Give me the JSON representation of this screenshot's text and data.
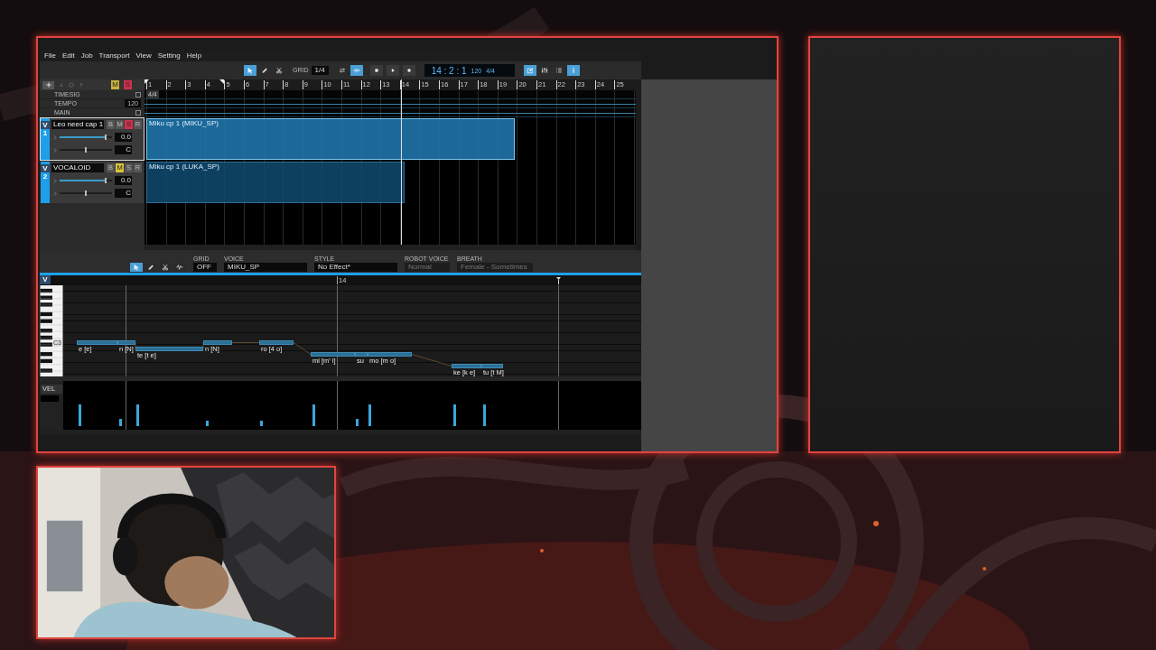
{
  "menu": [
    "File",
    "Edit",
    "Job",
    "Transport",
    "View",
    "Setting",
    "Help"
  ],
  "toolbar": {
    "tools": [
      {
        "kind": "select",
        "selected": true
      },
      {
        "kind": "pencil",
        "selected": false
      },
      {
        "kind": "scissors",
        "selected": false
      }
    ],
    "grid": {
      "label": "GRID",
      "value": "1/4"
    },
    "toggles": [
      {
        "kind": "loop",
        "on": false
      },
      {
        "kind": "snap",
        "on": true
      }
    ],
    "transport": [
      {
        "kind": "stop"
      },
      {
        "kind": "play"
      },
      {
        "kind": "record"
      }
    ],
    "time": "14 : 2 : 1",
    "tempo": "120",
    "meter": "4/4",
    "panels": [
      {
        "kind": "edit",
        "selected": true
      },
      {
        "kind": "mixer",
        "selected": false
      },
      {
        "kind": "list",
        "selected": false
      },
      {
        "kind": "info",
        "selected": true
      }
    ]
  },
  "arrangement": {
    "header_buttons": [
      {
        "label": "M",
        "kind": "mute"
      },
      {
        "label": "S",
        "kind": "solo"
      }
    ],
    "conductor": [
      {
        "label": "TIMESIG",
        "checked": false
      },
      {
        "label": "TEMPO",
        "value": "120"
      },
      {
        "label": "MAIN",
        "checked": false
      }
    ],
    "measures": [
      "1",
      "2",
      "3",
      "4",
      "5",
      "6",
      "7",
      "8",
      "9",
      "10",
      "11",
      "12",
      "13",
      "14",
      "15",
      "16",
      "17",
      "18",
      "19",
      "20",
      "21",
      "22",
      "23",
      "24",
      "25"
    ],
    "timesig_marker": "4/4",
    "tracks": [
      {
        "letter": "V",
        "number": "1",
        "name": "Leo need cap 1",
        "selected": true,
        "buttons": [
          {
            "label": "B",
            "kind": "bounce",
            "on": false
          },
          {
            "label": "M",
            "kind": "mute",
            "on": false
          },
          {
            "label": "S",
            "kind": "solo",
            "on": true
          },
          {
            "label": "R",
            "kind": "record",
            "on": false
          }
        ],
        "volume": {
          "level": 0.88,
          "reading": "0.0"
        },
        "pan": {
          "level": 0.5,
          "reading": "C"
        },
        "part": {
          "title": "Miku cp 1 (MIKU_SP)",
          "selected": true
        }
      },
      {
        "letter": "V",
        "number": "2",
        "name": "VOCALOID",
        "selected": false,
        "buttons": [
          {
            "label": "B",
            "kind": "bounce",
            "on": false
          },
          {
            "label": "M",
            "kind": "mute",
            "on": true
          },
          {
            "label": "S",
            "kind": "solo",
            "on": false
          },
          {
            "label": "R",
            "kind": "record",
            "on": false
          }
        ],
        "volume": {
          "level": 0.88,
          "reading": "0.0"
        },
        "pan": {
          "level": 0.5,
          "reading": "C"
        },
        "part": {
          "title": "Miku cp 1 (LUKA_SP)",
          "selected": false
        }
      }
    ]
  },
  "piano_roll": {
    "tools": [
      {
        "kind": "select",
        "selected": true
      },
      {
        "kind": "pencil",
        "selected": false
      },
      {
        "kind": "scissors",
        "selected": false
      },
      {
        "kind": "wave",
        "selected": false
      }
    ],
    "fields": [
      {
        "label": "GRID",
        "value": "OFF",
        "kind": "small",
        "disabled": false
      },
      {
        "label": "VOICE",
        "value": "MIKU_SP",
        "kind": "voice",
        "disabled": false
      },
      {
        "label": "STYLE",
        "value": "No Effect*",
        "kind": "voice",
        "disabled": false
      },
      {
        "label": "ROBOT VOICE",
        "value": "Normal",
        "kind": "check",
        "disabled": true
      },
      {
        "label": "BREATH",
        "value": "Female - Sometimes",
        "kind": "check",
        "disabled": true
      }
    ],
    "track_letter": "V",
    "measure": "14",
    "key_label": "C3",
    "notes": [
      {
        "lyric": "e [e]"
      },
      {
        "lyric": "n [N]"
      },
      {
        "lyric": "te [t e]"
      },
      {
        "lyric": "n [N]"
      },
      {
        "lyric": "ro [4 o]"
      },
      {
        "lyric": "mi [m' i]"
      },
      {
        "lyric": "su"
      },
      {
        "lyric": "mo [m o]"
      },
      {
        "lyric": "ke [k e]"
      },
      {
        "lyric": "tu [t M]"
      }
    ],
    "lane": "VEL"
  }
}
